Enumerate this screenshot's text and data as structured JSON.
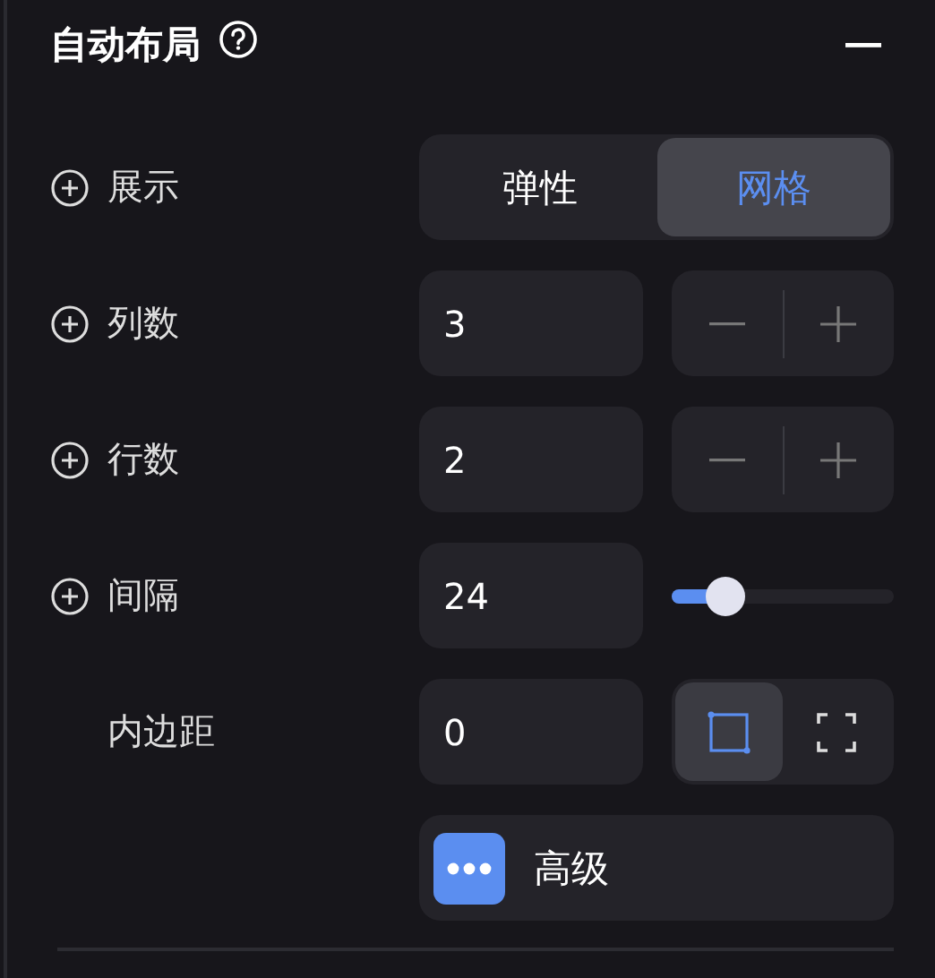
{
  "section": {
    "title": "自动布局"
  },
  "rows": [
    {
      "kind": "segmented",
      "label": "展示",
      "addable": true,
      "options": [
        {
          "label": "弹性",
          "selected": false
        },
        {
          "label": "网格",
          "selected": true
        }
      ]
    },
    {
      "kind": "stepper",
      "label": "列数",
      "addable": true,
      "value": "3"
    },
    {
      "kind": "stepper",
      "label": "行数",
      "addable": true,
      "value": "2"
    },
    {
      "kind": "slider",
      "label": "间隔",
      "addable": true,
      "value": "24",
      "level": 0.24
    },
    {
      "kind": "padding",
      "label": "内边距",
      "addable": false,
      "value": "0",
      "modes": [
        {
          "selected": true
        },
        {
          "selected": false
        }
      ]
    },
    {
      "kind": "advanced",
      "label": "高级"
    }
  ]
}
